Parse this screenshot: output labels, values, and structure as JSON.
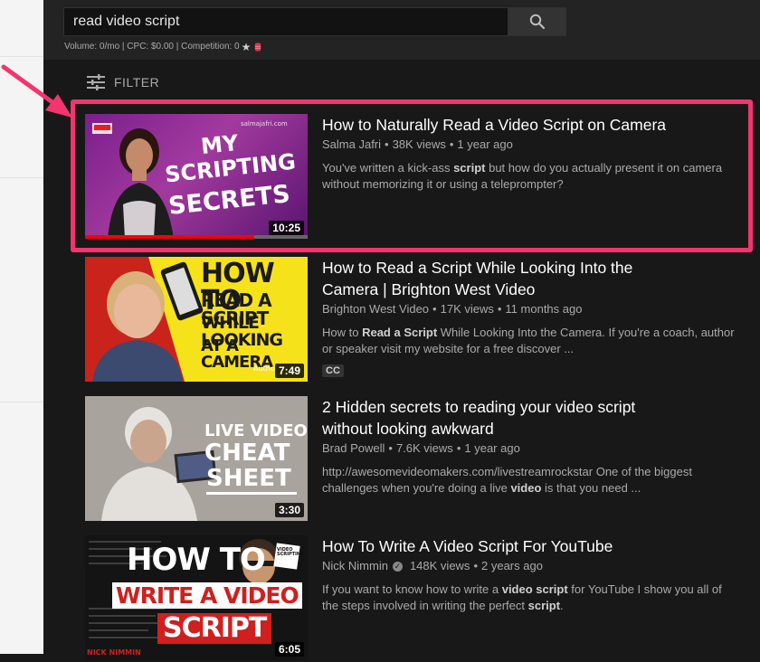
{
  "search": {
    "query": "read video script",
    "stats": "Volume: 0/mo | CPC: $0.00 | Competition: 0"
  },
  "filter": {
    "label": "FILTER"
  },
  "colors": {
    "accent_highlight": "#f2356e",
    "progress_red": "#ff0000",
    "background": "#181818"
  },
  "results": [
    {
      "title": "How to Naturally Read a Video Script on Camera",
      "channel": "Salma Jafri",
      "views": "38K views",
      "age": "1 year ago",
      "desc_line1_pre": "You've written a kick-ass ",
      "desc_line1_bold": "script",
      "desc_line1_post": " but how do you actually present it on camera",
      "desc_line2": "without memorizing it or using a teleprompter?",
      "duration": "10:25",
      "watched_fraction": 0.76,
      "thumb_text": [
        "MY",
        "SCRIPTING",
        "SECRETS"
      ],
      "thumb_brand": "salmajafri.com",
      "thumb_badge": "YouTube Certified"
    },
    {
      "title_line1": "How to Read a Script While Looking Into the",
      "title_line2": "Camera | Brighton West Video",
      "channel": "Brighton West Video",
      "views": "17K views",
      "age": "11 months ago",
      "desc_line1_pre": "How to ",
      "desc_line1_bold": "Read a Script",
      "desc_line1_post": " While Looking Into the Camera. If you're a coach, author",
      "desc_line2": "or speaker visit my website for a free discover ...",
      "badge": "CC",
      "duration": "7:49",
      "thumb_text": [
        "HOW TO",
        "READ A SCRIPT",
        "WHILE LOOKING",
        "AT A CAMERA"
      ],
      "thumb_corner": "Autho"
    },
    {
      "title_line1": "2 Hidden secrets to reading your video script",
      "title_line2": "without looking awkward",
      "channel": "Brad Powell",
      "views": "7.6K views",
      "age": "1 year ago",
      "desc_line1": "http://awesomevideomakers.com/livestreamrockstar One of the biggest",
      "desc_line2_pre": "challenges when you're doing a live ",
      "desc_line2_bold": "video",
      "desc_line2_post": " is that you need ...",
      "duration": "3:30",
      "thumb_text": [
        "LIVE VIDEO",
        "CHEAT",
        "SHEET"
      ]
    },
    {
      "title": "How To Write A Video Script For YouTube",
      "channel": "Nick Nimmin",
      "views": "148K views",
      "age": "2 years ago",
      "desc_line1_pre": "If you want to know how to write a ",
      "desc_line1_bold": "video script",
      "desc_line1_post": " for YouTube I show you all of",
      "desc_line2_pre": "the steps involved in writing the perfect ",
      "desc_line2_bold": "script",
      "desc_line2_post": ".",
      "duration": "6:05",
      "thumb_text": [
        "HOW TO",
        "WRITE A VIDEO",
        "SCRIPT"
      ],
      "thumb_sign": "VIDEO SCRIPTING",
      "thumb_corner": "NICK NIMMIN"
    }
  ]
}
